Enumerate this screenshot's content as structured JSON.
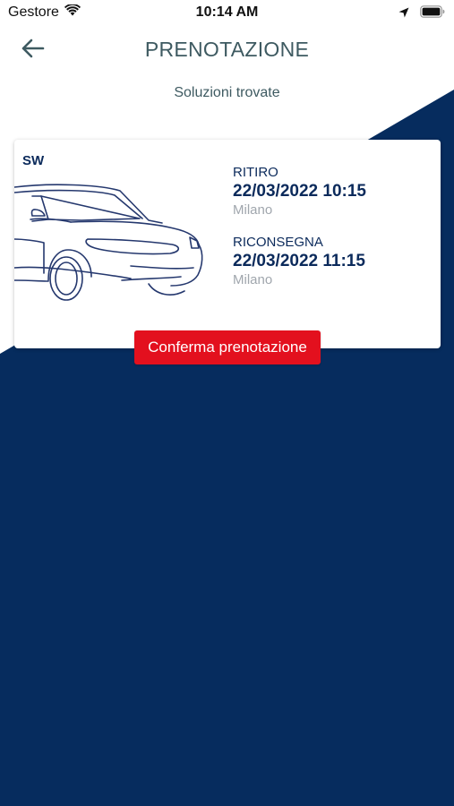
{
  "status_bar": {
    "carrier": "Gestore",
    "time": "10:14 AM"
  },
  "header": {
    "title": "PRENOTAZIONE",
    "subtitle": "Soluzioni trovate"
  },
  "result_card": {
    "category": "SW",
    "pickup": {
      "label": "RITIRO",
      "datetime": "22/03/2022 10:15",
      "location": "Milano"
    },
    "return": {
      "label": "RICONSEGNA",
      "datetime": "22/03/2022 11:15",
      "location": "Milano"
    },
    "confirm_label": "Conferma prenotazione"
  },
  "icons": {
    "back": "arrow-left-icon",
    "wifi": "wifi-icon",
    "location": "location-arrow-icon",
    "battery": "battery-icon",
    "car": "car-outline-icon"
  },
  "colors": {
    "navy": "#062c5e",
    "title_text": "#3e5a61",
    "card_text": "#0b2a5b",
    "muted_text": "#a0a6ad",
    "accent_red": "#e3101e"
  }
}
